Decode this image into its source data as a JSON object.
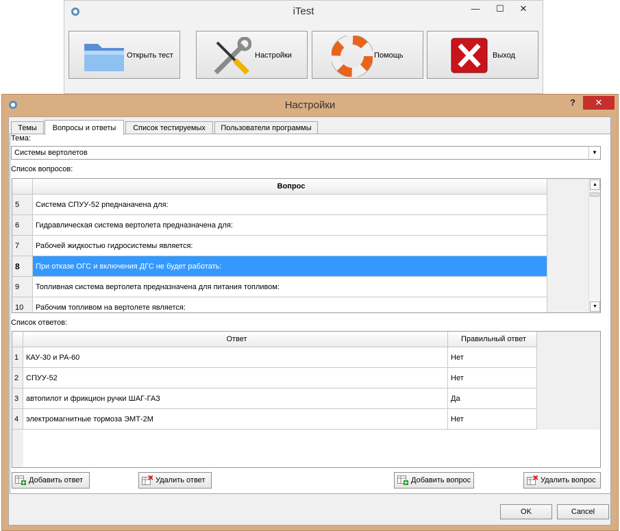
{
  "main_window": {
    "title": "iTest",
    "buttons": [
      {
        "label": "Открыть тест",
        "icon": "folder-icon"
      },
      {
        "label": "Настройки",
        "icon": "tools-icon"
      },
      {
        "label": "Помощь",
        "icon": "lifebuoy-icon"
      },
      {
        "label": "Выход",
        "icon": "exit-x-icon"
      }
    ],
    "controls": {
      "minimize": "—",
      "maximize": "☐",
      "close": "✕"
    }
  },
  "settings_dialog": {
    "title": "Настройки",
    "controls": {
      "help": "?",
      "close": "✕"
    },
    "tabs": [
      {
        "label": "Темы",
        "active": false
      },
      {
        "label": "Вопросы и ответы",
        "active": true
      },
      {
        "label": "Список тестируемых",
        "active": false
      },
      {
        "label": "Пользователи программы",
        "active": false
      }
    ],
    "topic_label": "Тема:",
    "topic_value": "Системы вертолетов",
    "questions_label": "Список вопросов:",
    "questions": {
      "column": "Вопрос",
      "selected_number": "8",
      "rows": [
        {
          "n": "5",
          "text": "Система СПУУ-52 рпеднаначена  для:"
        },
        {
          "n": "6",
          "text": "Гидравлическая система вертолета предназначена  для:"
        },
        {
          "n": "7",
          "text": "Рабочей жидкостью гидросистемы является:"
        },
        {
          "n": "8",
          "text": "При отказе ОГС и включения ДГС не будет работать:"
        },
        {
          "n": "9",
          "text": "Топливная система вертолета предназначена для питания топливом:"
        },
        {
          "n": "10",
          "text": "Рабочим топливом на вертолете является:"
        }
      ]
    },
    "answers_label": "Список ответов:",
    "answers": {
      "columns": [
        "Ответ",
        "Правильный ответ"
      ],
      "rows": [
        {
          "n": "1",
          "text": "КАУ-30 и РА-60",
          "correct": "Нет"
        },
        {
          "n": "2",
          "text": "СПУУ-52",
          "correct": "Нет"
        },
        {
          "n": "3",
          "text": "автопилот и фрикцион ручки ШАГ-ГАЗ",
          "correct": "Да"
        },
        {
          "n": "4",
          "text": "электромагнитные тормоза ЭМТ-2М",
          "correct": "Нет"
        }
      ]
    },
    "buttons": {
      "add_answer": "Добавить ответ",
      "delete_answer": "Удалить ответ",
      "add_question": "Добавить вопрос",
      "delete_question": "Удалить вопрос",
      "ok": "OK",
      "cancel": "Cancel"
    }
  }
}
